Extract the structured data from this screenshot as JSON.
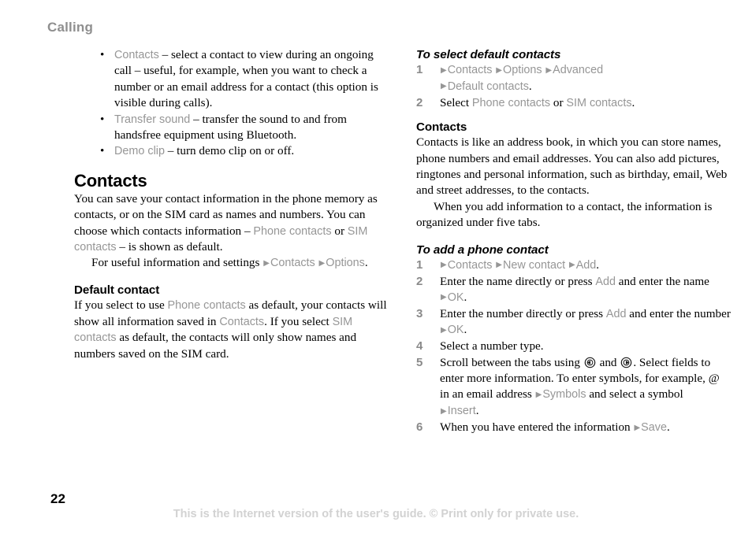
{
  "running_head": "Calling",
  "page_number": "22",
  "footer_note": "This is the Internet version of the user's guide. © Print only for private use.",
  "colors": {
    "ui_term_gray": "#969696",
    "running_head_gray": "#8f8f8f",
    "step_number_gray": "#8a8a8a",
    "footer_gray": "#d2d2d2",
    "body_black": "#000000"
  },
  "left_column": {
    "bullets": [
      {
        "term": "Contacts",
        "text": " – select a contact to view during an ongoing call – useful, for example, when you want to check a number or an email address for a contact (this option is visible during calls)."
      },
      {
        "term": "Transfer sound",
        "text": " – transfer the sound to and from handsfree equipment using Bluetooth."
      },
      {
        "term": "Demo clip",
        "text": " – turn demo clip on or off."
      }
    ],
    "contacts_heading": "Contacts",
    "contacts_para_1a": "You can save your contact information in the phone memory as contacts, or on the SIM card as names and numbers. You can choose which contacts information – ",
    "contacts_term_1": "Phone contacts",
    "contacts_para_1b": " or ",
    "contacts_term_2": "SIM contacts",
    "contacts_para_1c": " – is shown as default.",
    "contacts_para_2a": "For useful information and settings ",
    "contacts_term_3": "Contacts",
    "contacts_term_4": "Options",
    "contacts_para_2b": ".",
    "default_heading": "Default contact",
    "default_para_a": "If you select to use ",
    "default_term_1": "Phone contacts",
    "default_para_b": " as default, your contacts will show all information saved in ",
    "default_term_2": "Contacts",
    "default_para_c": ". If you select ",
    "default_term_3": "SIM contacts",
    "default_para_d": " as default, the contacts will only show names and numbers saved on the SIM card."
  },
  "right_column": {
    "proc1_heading": "To select default contacts",
    "proc1_steps": [
      {
        "number": "1",
        "terms": [
          "Contacts",
          "Options",
          "Advanced",
          "Default contacts"
        ],
        "trailing": "."
      },
      {
        "number": "2",
        "lead": "Select ",
        "term_a": "Phone contacts",
        "middle": " or ",
        "term_b": "SIM contacts",
        "trailing": "."
      }
    ],
    "contacts_heading": "Contacts",
    "contacts_para_1": "Contacts is like an address book, in which you can store names, phone numbers and email addresses. You can also add pictures, ringtones and personal information, such as birthday, email, Web and street addresses, to the contacts.",
    "contacts_para_2": "When you add information to a contact, the information is organized under five tabs.",
    "proc2_heading": "To add a phone contact",
    "proc2_steps": [
      {
        "number": "1",
        "terms": [
          "Contacts",
          "New contact",
          "Add"
        ],
        "trailing": "."
      },
      {
        "number": "2",
        "part_a": "Enter the name directly or press ",
        "term_a": "Add",
        "part_b": " and enter the name ",
        "term_b": "OK",
        "trailing": "."
      },
      {
        "number": "3",
        "part_a": "Enter the number directly or press ",
        "term_a": "Add",
        "part_b": " and enter the number ",
        "term_b": "OK",
        "trailing": "."
      },
      {
        "number": "4",
        "text": "Select a number type."
      },
      {
        "number": "5",
        "part_a": "Scroll between the tabs using ",
        "icon_left": "nav-key-left-icon",
        "part_b": " and ",
        "icon_right": "nav-key-right-icon",
        "part_c": ". Select fields to enter more information. To enter symbols, for example, ",
        "symbol_at": "@",
        "part_d": " in an email address ",
        "term_a": "Symbols",
        "part_e": " and select a symbol ",
        "term_b": "Insert",
        "trailing": "."
      },
      {
        "number": "6",
        "part_a": "When you have entered the information ",
        "term_a": "Save",
        "trailing": "."
      }
    ]
  }
}
